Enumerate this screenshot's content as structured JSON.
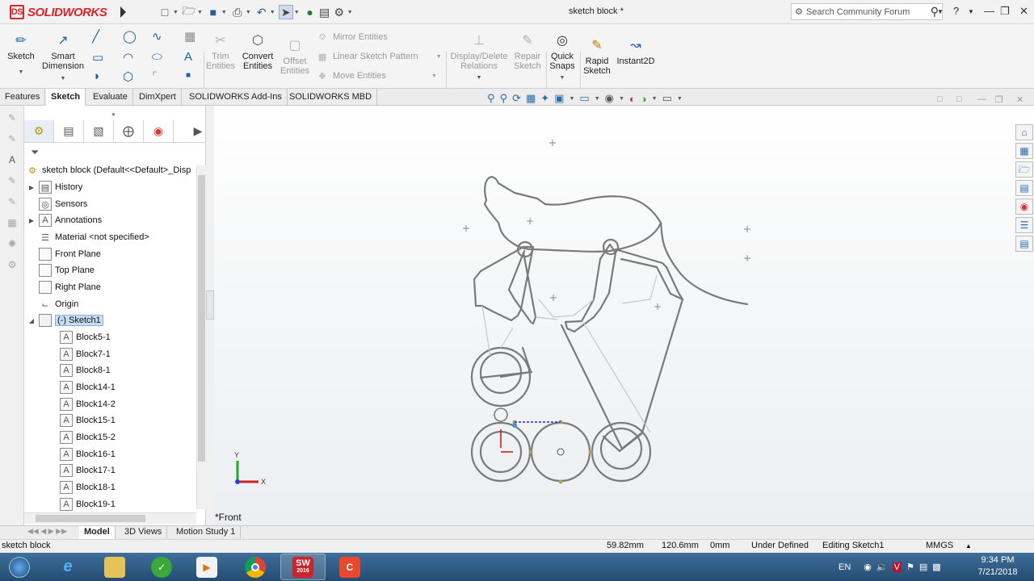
{
  "app": {
    "brand": "SOLIDWORKS",
    "brand_mark": "DS",
    "document_title": "sketch block *"
  },
  "search": {
    "placeholder": "Search Community Forum"
  },
  "ribbon": {
    "sketch": "Sketch",
    "smart_dimension": [
      "Smart",
      "Dimension"
    ],
    "trim_entities": [
      "Trim",
      "Entities"
    ],
    "convert_entities": [
      "Convert",
      "Entities"
    ],
    "offset_entities": [
      "Offset",
      "Entities"
    ],
    "mirror_entities": "Mirror Entities",
    "linear_sketch_pattern": "Linear Sketch Pattern",
    "move_entities": "Move Entities",
    "display_delete_relations": [
      "Display/Delete",
      "Relations"
    ],
    "repair_sketch": [
      "Repair",
      "Sketch"
    ],
    "quick_snaps": [
      "Quick",
      "Snaps"
    ],
    "rapid_sketch": [
      "Rapid",
      "Sketch"
    ],
    "instant2d": "Instant2D"
  },
  "tabs": [
    "Features",
    "Sketch",
    "Evaluate",
    "DimXpert",
    "SOLIDWORKS Add-Ins",
    "SOLIDWORKS MBD"
  ],
  "active_tab": "Sketch",
  "tree": {
    "root": "sketch block  (Default<<Default>_Disp",
    "items": [
      {
        "label": "History",
        "icon": "history-icon"
      },
      {
        "label": "Sensors",
        "icon": "sensors-icon"
      },
      {
        "label": "Annotations",
        "icon": "annotations-icon"
      },
      {
        "label": "Material <not specified>",
        "icon": "material-icon"
      },
      {
        "label": "Front Plane",
        "icon": "plane-icon"
      },
      {
        "label": "Top Plane",
        "icon": "plane-icon"
      },
      {
        "label": "Right Plane",
        "icon": "plane-icon"
      },
      {
        "label": "Origin",
        "icon": "origin-icon"
      },
      {
        "label": "(-) Sketch1",
        "icon": "sketch-icon"
      }
    ],
    "blocks": [
      "Block5-1",
      "Block7-1",
      "Block8-1",
      "Block14-1",
      "Block14-2",
      "Block15-1",
      "Block15-2",
      "Block16-1",
      "Block17-1",
      "Block18-1",
      "Block19-1"
    ]
  },
  "canvas": {
    "view_label": "*Front",
    "axis_x": "X",
    "axis_y": "Y"
  },
  "bottom_tabs": [
    "Model",
    "3D Views",
    "Motion Study 1"
  ],
  "status": {
    "doc": "sketch block",
    "x": "59.82mm",
    "y": "120.6mm",
    "z": "0mm",
    "state": "Under Defined",
    "editing": "Editing Sketch1",
    "units": "MMGS"
  },
  "taskbar": {
    "apps": [
      {
        "name": "start-button"
      },
      {
        "name": "internet-explorer"
      },
      {
        "name": "file-explorer"
      },
      {
        "name": "green-app"
      },
      {
        "name": "media-player"
      },
      {
        "name": "chrome"
      },
      {
        "name": "solidworks-2016",
        "label": "SW",
        "sub": "2016"
      },
      {
        "name": "camtasia"
      }
    ],
    "lang": "EN",
    "time": "9:34 PM",
    "date": "7/21/2018"
  }
}
